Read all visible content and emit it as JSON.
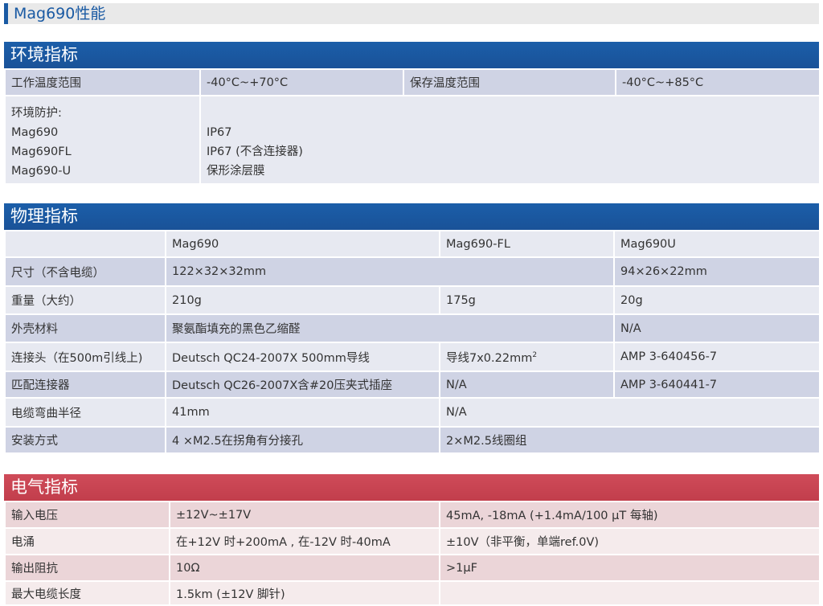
{
  "title": "Mag690性能",
  "environment": {
    "header": "环境指标",
    "row1": [
      "工作温度范围",
      "-40°C~+70°C",
      "保存温度范围",
      "-40°C~+85°C"
    ],
    "protection": {
      "labels": [
        "环境防护:",
        "Mag690",
        "Mag690FL",
        "Mag690-U"
      ],
      "values": [
        "IP67",
        "IP67 (不含连接器)",
        "保形涂层膜"
      ]
    }
  },
  "physical": {
    "header": "物理指标",
    "columns": [
      "Mag690",
      "Mag690-FL",
      "Mag690U"
    ],
    "size": [
      "尺寸（不含电缆）",
      "122×32×32mm",
      "94×26×22mm"
    ],
    "weight": [
      "重量（大约）",
      "210g",
      "175g",
      "20g"
    ],
    "housing": [
      "外壳材料",
      "聚氨酯填充的黑色乙缩醛",
      "N/A"
    ],
    "connector": [
      "连接头（在500m引线上)",
      "Deutsch QC24-2007X 500mm导线",
      "导线7x0.22mm",
      "2",
      "AMP 3-640456-7"
    ],
    "mating": [
      "匹配连接器",
      "Deutsch QC26-2007X含#20压夹式插座",
      "N/A",
      "AMP 3-640441-7"
    ],
    "bend": [
      "电缆弯曲半径",
      "41mm",
      "N/A"
    ],
    "mounting": [
      "安装方式",
      "4 ×M2.5在拐角有分接孔",
      "2×M2.5线圈组"
    ]
  },
  "electrical": {
    "header": "电气指标",
    "rows": [
      [
        "输入电压",
        "±12V~±17V",
        "45mA, -18mA (+1.4mA/100 µT 每轴)"
      ],
      [
        "电涌",
        "在+12V 时+200mA , 在-12V 时-40mA",
        "±10V（非平衡，单端ref.0V)"
      ],
      [
        "输出阻抗",
        "10Ω",
        ">1µF"
      ],
      [
        "最大电缆长度",
        "1.5km (±12V 脚针)",
        ""
      ]
    ]
  }
}
